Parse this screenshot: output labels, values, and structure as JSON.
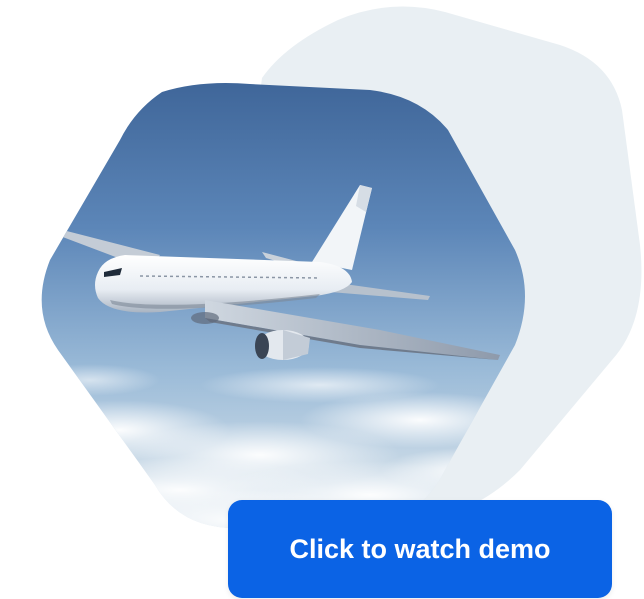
{
  "demo_button": {
    "label": "Click to watch demo",
    "background_color": "#0b63e5",
    "text_color": "#ffffff"
  },
  "colors": {
    "background": "#ffffff",
    "decorative_hexagon": "#e9eff3",
    "sky_top": "#3a5f92",
    "sky_mid": "#7fa6ce",
    "clouds": "#e8eef4"
  },
  "media": {
    "image_subject": "airplane-in-flight-photo"
  }
}
